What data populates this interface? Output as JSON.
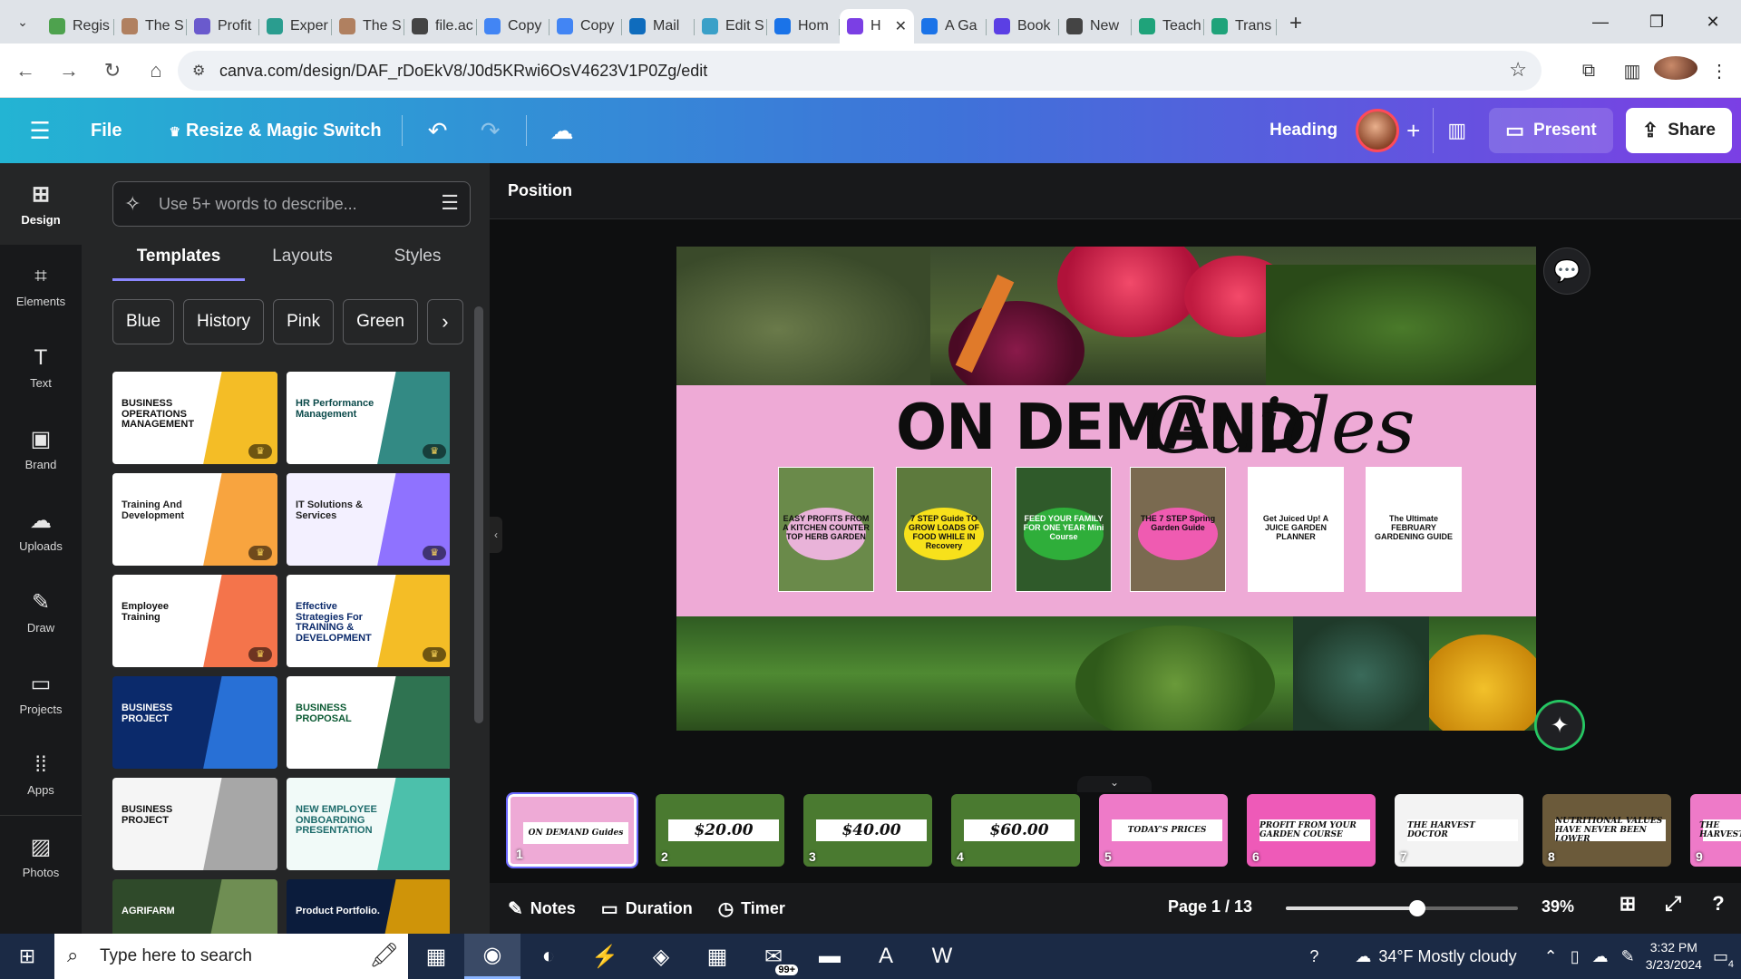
{
  "browser": {
    "tabs": [
      {
        "label": "Regis",
        "color": "#4ea24e"
      },
      {
        "label": "The S",
        "color": "#b08060"
      },
      {
        "label": "Profit",
        "color": "#6a5acd"
      },
      {
        "label": "Exper",
        "color": "#2a9d8f"
      },
      {
        "label": "The S",
        "color": "#b08060"
      },
      {
        "label": "file.ac",
        "color": "#444"
      },
      {
        "label": "Copy",
        "color": "#4285f4"
      },
      {
        "label": "Copy",
        "color": "#4285f4"
      },
      {
        "label": "Mail",
        "color": "#0f6cbd"
      },
      {
        "label": "Edit S",
        "color": "#3aa0c8"
      },
      {
        "label": "Hom",
        "color": "#1a73e8"
      },
      {
        "label": "H",
        "color": "#7b3fe4",
        "active": true
      },
      {
        "label": "A Ga",
        "color": "#1a73e8"
      },
      {
        "label": "Book",
        "color": "#5b3fe4"
      },
      {
        "label": "New",
        "color": "#444"
      },
      {
        "label": "Teach",
        "color": "#1fa37a"
      },
      {
        "label": "Trans",
        "color": "#1fa37a"
      }
    ],
    "url": "canva.com/design/DAF_rDoEkV8/J0d5KRwi6OsV4623V1P0Zg/edit"
  },
  "header": {
    "file": "File",
    "resize": "Resize & Magic Switch",
    "heading": "Heading",
    "present": "Present",
    "share": "Share"
  },
  "rail": [
    {
      "label": "Design",
      "icon": "⊞",
      "active": true
    },
    {
      "label": "Elements",
      "icon": "⌗"
    },
    {
      "label": "Text",
      "icon": "T"
    },
    {
      "label": "Brand",
      "icon": "▣"
    },
    {
      "label": "Uploads",
      "icon": "☁"
    },
    {
      "label": "Draw",
      "icon": "✎"
    },
    {
      "label": "Projects",
      "icon": "▭"
    },
    {
      "label": "Apps",
      "icon": "⁞⁞"
    },
    {
      "label": "Photos",
      "icon": "▨"
    }
  ],
  "panel": {
    "search_placeholder": "Use 5+ words to describe...",
    "tabs": [
      "Templates",
      "Layouts",
      "Styles"
    ],
    "chips": [
      "Blue",
      "History",
      "Pink",
      "Green"
    ],
    "templates": [
      {
        "text": "BUSINESS OPERATIONS MANAGEMENT",
        "bg": "#ffffff",
        "fg": "#111",
        "accent": "#f2b100"
      },
      {
        "text": "HR Performance Management",
        "bg": "#ffffff",
        "fg": "#0b4a4a",
        "accent": "#0f766e"
      },
      {
        "text": "Training And Development",
        "bg": "#ffffff",
        "fg": "#222",
        "accent": "#f7941d"
      },
      {
        "text": "IT Solutions & Services",
        "bg": "#f3f0ff",
        "fg": "#222",
        "accent": "#7c5cff"
      },
      {
        "text": "Employee Training",
        "bg": "#ffffff",
        "fg": "#111",
        "accent": "#f25c2b"
      },
      {
        "text": "Effective Strategies For TRAINING & DEVELOPMENT",
        "bg": "#ffffff",
        "fg": "#0b2a6b",
        "accent": "#f2b100"
      },
      {
        "text": "BUSINESS PROJECT",
        "bg": "#0b2a6b",
        "fg": "#ffffff",
        "accent": "#2e7de9"
      },
      {
        "text": "BUSINESS PROPOSAL",
        "bg": "#ffffff",
        "fg": "#0b5a33",
        "accent": "#0b5a33"
      },
      {
        "text": "BUSINESS PROJECT",
        "bg": "#f5f5f5",
        "fg": "#111",
        "accent": "#999"
      },
      {
        "text": "NEW EMPLOYEE ONBOARDING PRESENTATION",
        "bg": "#f1faf8",
        "fg": "#1d6b6b",
        "accent": "#2fb59d"
      },
      {
        "text": "AGRIFARM",
        "bg": "#2f4a2a",
        "fg": "#ffffff",
        "accent": "#7a9a5a"
      },
      {
        "text": "Product Portfolio.",
        "bg": "#0b1c3c",
        "fg": "#ffffff",
        "accent": "#f2a900"
      }
    ]
  },
  "editor": {
    "position_label": "Position",
    "slide": {
      "title_a": "ON DEMAND",
      "title_b": "Guides",
      "cards": [
        {
          "text": "EASY PROFITS FROM A KITCHEN COUNTER TOP HERB GARDEN",
          "bg": "#6a8a4a",
          "badge": "#e9b3d9"
        },
        {
          "text": "7 STEP Guide TO GROW LOADS OF FOOD WHILE IN Recovery",
          "bg": "#5d7a3d",
          "badge": "#f7e11b"
        },
        {
          "text": "FEED YOUR FAMILY FOR ONE YEAR Mini Course",
          "bg": "#2f5a2a",
          "badge": "#2fae3a"
        },
        {
          "text": "THE 7 STEP Spring Garden Guide",
          "bg": "#7a6a50",
          "badge": "#ef5bb1"
        },
        {
          "text": "Get Juiced Up! A JUICE GARDEN PLANNER",
          "bg": "#ffffff",
          "badge": "#ffffff"
        },
        {
          "text": "The Ultimate FEBRUARY GARDENING GUIDE",
          "bg": "#ffffff",
          "badge": "#ffffff"
        }
      ]
    },
    "pages": [
      {
        "num": "1",
        "text": "ON DEMAND Guides",
        "bg": "#eeaad6"
      },
      {
        "num": "2",
        "text": "$20.00",
        "bg": "#4a7a30"
      },
      {
        "num": "3",
        "text": "$40.00",
        "bg": "#4a7a30"
      },
      {
        "num": "4",
        "text": "$60.00",
        "bg": "#4a7a30"
      },
      {
        "num": "5",
        "text": "TODAY'S PRICES",
        "bg": "#ee7ac8"
      },
      {
        "num": "6",
        "text": "PROFIT FROM YOUR GARDEN COURSE",
        "bg": "#ee5ab8"
      },
      {
        "num": "7",
        "text": "THE HARVEST DOCTOR",
        "bg": "#f3f3f3"
      },
      {
        "num": "8",
        "text": "NUTRITIONAL VALUES HAVE NEVER BEEN LOWER",
        "bg": "#6b5a3a"
      },
      {
        "num": "9",
        "text": "THE HARVEST",
        "bg": "#ee7ac8"
      }
    ],
    "footer": {
      "notes": "Notes",
      "duration": "Duration",
      "timer": "Timer",
      "page": "Page 1 / 13",
      "zoom_label": "39%",
      "zoom_fraction": 0.39
    }
  },
  "taskbar": {
    "search": "Type here to search",
    "badge": "99+",
    "weather": "34°F  Mostly cloudy",
    "time": "3:32 PM",
    "date": "3/23/2024",
    "notif": "4"
  }
}
